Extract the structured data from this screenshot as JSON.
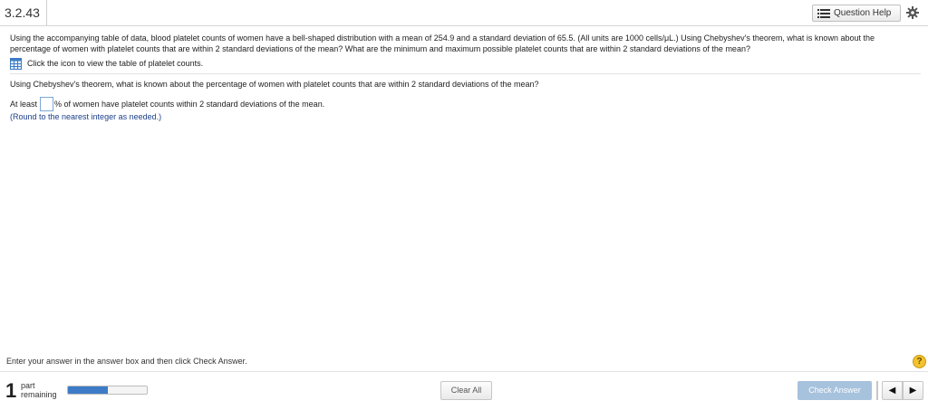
{
  "header": {
    "question_number": "3.2.43",
    "question_help_label": "Question Help",
    "settings_icon": "gear-icon",
    "help_icon": "list-icon"
  },
  "problem": {
    "text": "Using the accompanying table of data, blood platelet counts of women have a bell-shaped distribution with a mean of 254.9 and a standard deviation of 65.5. (All units are 1000 cells/μL.) Using Chebyshev's theorem, what is known about the percentage of women with platelet counts that are within 2 standard deviations of the mean? What are the minimum and maximum possible platelet counts that are within 2 standard deviations of the mean?",
    "table_link_text": "Click the icon to view the table of platelet counts.",
    "table_icon": "table-icon"
  },
  "question": {
    "text": "Using Chebyshev's theorem, what is known about the percentage of women with platelet counts that are within 2 standard deviations of the mean?",
    "answer_prefix": "At least",
    "answer_value": "",
    "answer_suffix": "% of women have platelet counts within 2 standard deviations of the mean.",
    "round_note": "(Round to the nearest integer as needed.)"
  },
  "footer": {
    "instruction": "Enter your answer in the answer box and then click Check Answer.",
    "help_symbol": "?",
    "parts_count": "1",
    "parts_label_line1": "part",
    "parts_label_line2": "remaining",
    "progress_fraction": 0.5,
    "clear_all_label": "Clear All",
    "check_answer_label": "Check Answer",
    "prev_symbol": "◀",
    "next_symbol": "▶"
  },
  "colors": {
    "accent": "#3d7bc7",
    "check_button": "#a7c2dd",
    "help_badge": "#f2c230",
    "note_text": "#1b3f8b"
  }
}
